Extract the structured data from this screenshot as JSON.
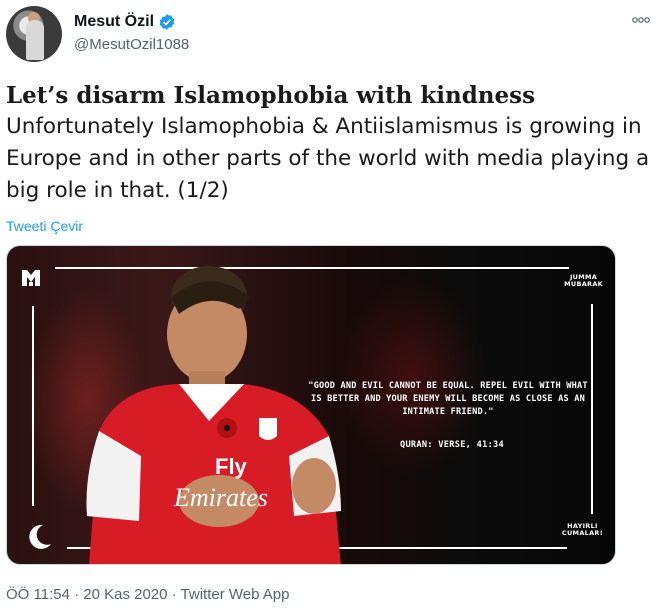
{
  "author": {
    "display_name": "Mesut Özil",
    "handle": "@MesutOzil1088",
    "verified": true,
    "verified_color": "#1d9bf0"
  },
  "tweet": {
    "headline": "Let’s disarm Islamophobia with kindness",
    "body": "Unfortunately Islamophobia & Antiislamismus is growing in Europe and in other parts of the world with media playing a big role in that. (1/2)",
    "translate_label": "Tweeti Çevir",
    "footer": "ÖÖ 11:54 · 20 Kas 2020 · Twitter Web App"
  },
  "media": {
    "corner_top": "JUMMA\nMUBARAK",
    "quote": "\"GOOD AND EVIL CANNOT BE EQUAL. REPEL EVIL WITH WHAT IS BETTER AND YOUR ENEMY WILL BECOME AS CLOSE AS AN INTIMATE FRIEND.\"",
    "verse": "QURAN: VERSE, 41:34",
    "corner_bottom": "HAYIRLI\nCUMALAR!",
    "shirt_text": "Fly Emirates",
    "shirt_color": "#d81c26"
  },
  "icons": {
    "more": "more-icon",
    "verified": "verified-badge-icon",
    "logo": "m10-logo-icon",
    "moon": "crescent-moon-icon"
  }
}
